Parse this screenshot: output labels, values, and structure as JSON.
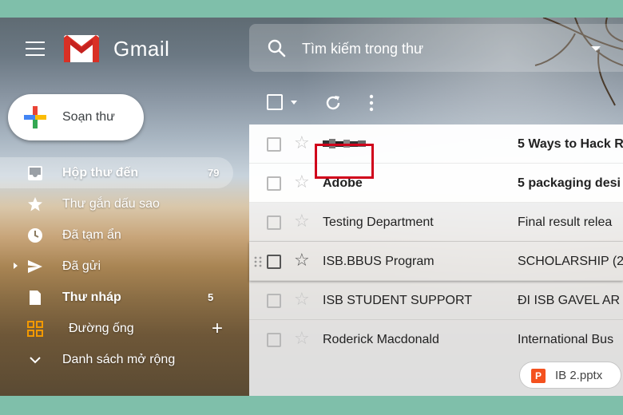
{
  "header": {
    "brand": "Gmail",
    "search_placeholder": "Tìm kiếm trong thư"
  },
  "compose": {
    "label": "Soạn thư"
  },
  "sidebar": {
    "items": [
      {
        "label": "Hộp thư đến",
        "count": "79",
        "icon": "inbox-icon",
        "active": true,
        "bold": true
      },
      {
        "label": "Thư gắn dấu sao",
        "icon": "star-icon"
      },
      {
        "label": "Đã tạm ẩn",
        "icon": "clock-icon"
      },
      {
        "label": "Đã gửi",
        "icon": "send-icon"
      },
      {
        "label": "Thư nháp",
        "count": "5",
        "icon": "draft-icon",
        "bold": true
      },
      {
        "label": "Đường ống",
        "icon": "pipeline-icon"
      },
      {
        "label": "Danh sách mở rộng",
        "icon": "chevron-down-icon"
      }
    ]
  },
  "emails": [
    {
      "sender": "",
      "subject": "5 Ways to Hack R",
      "unread": true,
      "sender_redacted": true
    },
    {
      "sender": "Adobe",
      "subject": "5 packaging desi",
      "unread": true
    },
    {
      "sender": "Testing Department",
      "subject": "Final result relea",
      "unread": false
    },
    {
      "sender": "ISB.BBUS Program",
      "subject": "SCHOLARSHIP (2",
      "unread": false
    },
    {
      "sender": "ISB STUDENT SUPPORT",
      "subject": "ĐI ISB GAVEL AR",
      "unread": false
    },
    {
      "sender": "Roderick Macdonald",
      "subject": "International Bus",
      "unread": false,
      "attachment": "IB 2.pptx"
    }
  ],
  "colors": {
    "highlight": "#d0021b",
    "gmail_red": "#d93025",
    "ppt_orange": "#f4511e"
  }
}
